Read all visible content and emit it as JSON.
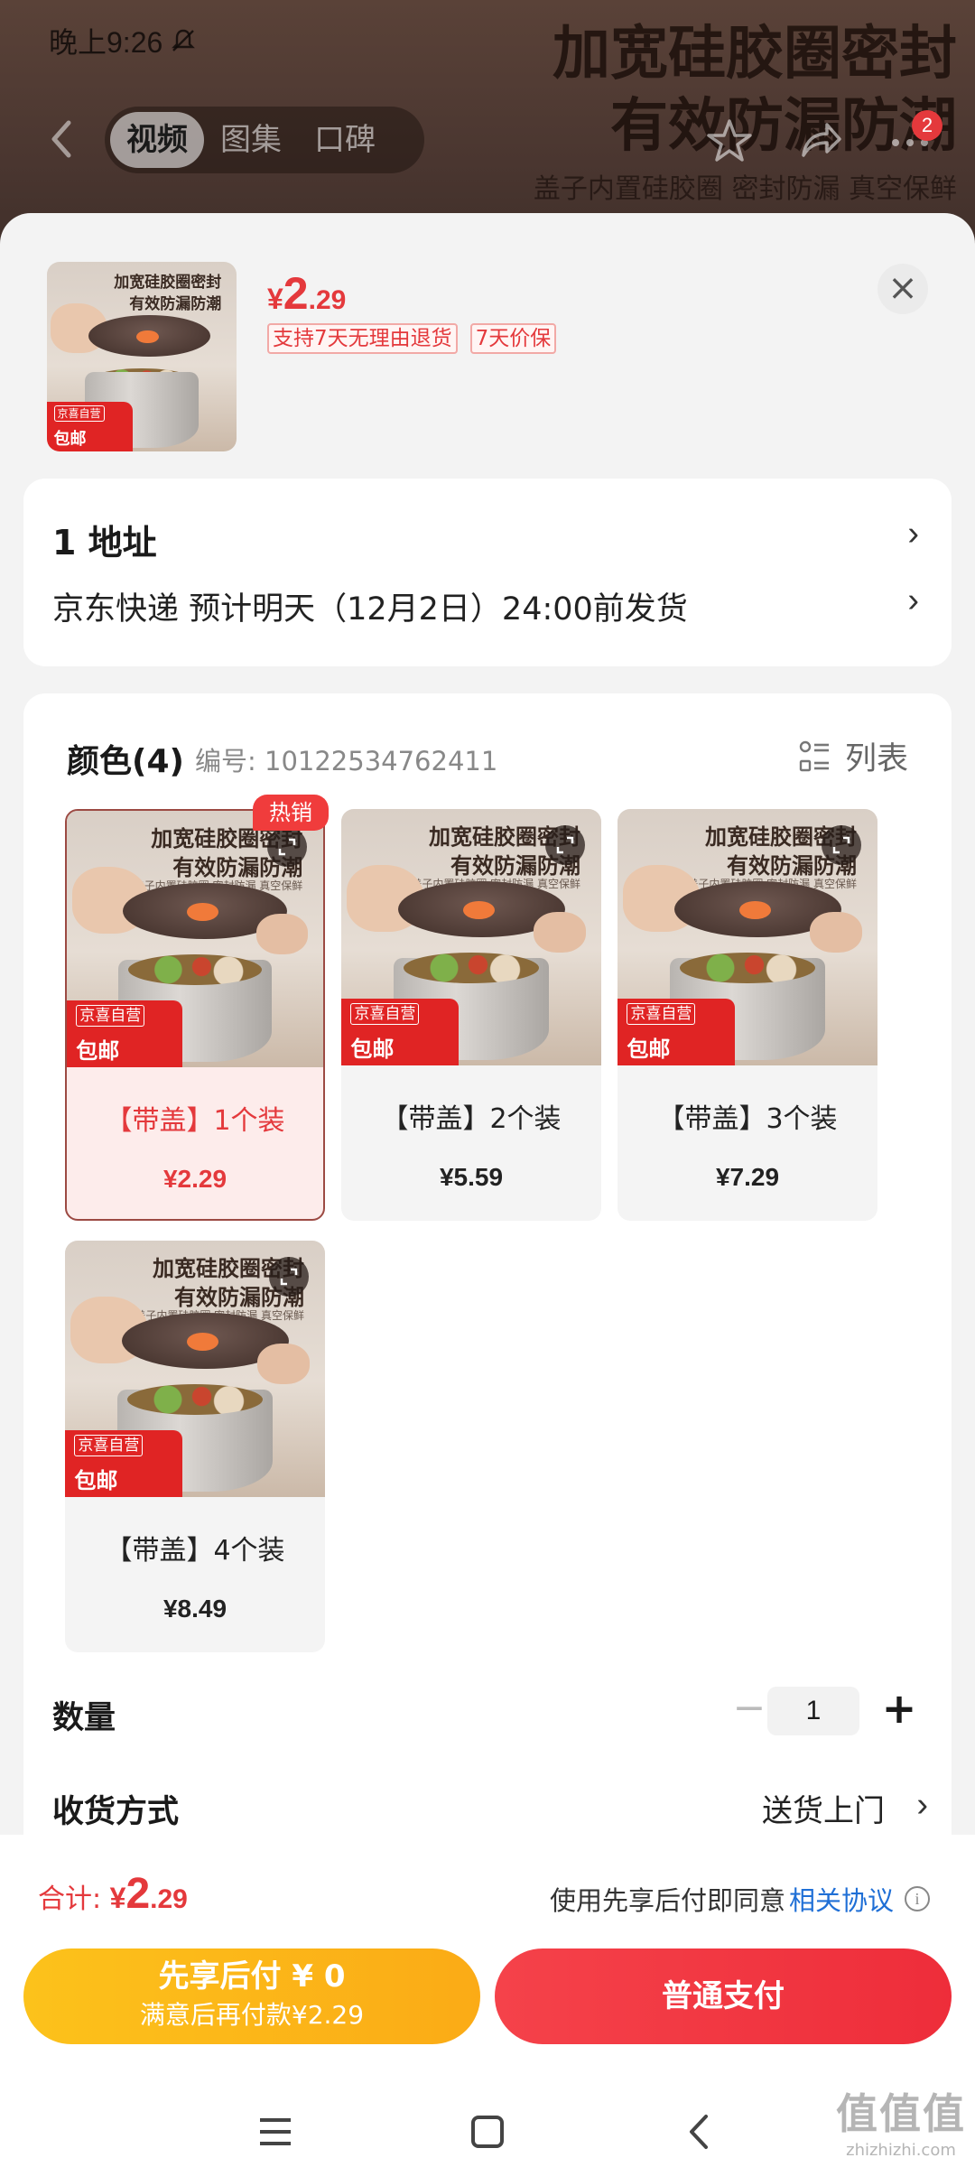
{
  "status_bar": {
    "time": "晚上9:26"
  },
  "background": {
    "hero_line1": "加宽硅胶圈密封",
    "hero_line2": "有效防漏防潮",
    "hero_sub": "盖子内置硅胶圈 密封防漏 真空保鲜"
  },
  "top_nav": {
    "tabs": [
      {
        "label": "视频",
        "active": true
      },
      {
        "label": "图集",
        "active": false
      },
      {
        "label": "口碑",
        "active": false
      }
    ],
    "cart_badge": "2"
  },
  "product_header": {
    "currency": "¥",
    "price_int": "2",
    "price_dec": ".29",
    "tags": [
      "支持7天无理由退货",
      "7天价保"
    ],
    "close_icon": "close-icon"
  },
  "photo_text": {
    "line1": "加宽硅胶圈密封",
    "line2": "有效防漏防潮",
    "line3": "盖子内置硅胶圈 密封防漏 真空保鲜",
    "badge_top": "京喜自营",
    "badge_bottom": "包邮"
  },
  "address": {
    "title": "1  地址",
    "delivery": "京东快递 预计明天（12月2日）24:00前发货"
  },
  "spec": {
    "title": "颜色(4)",
    "sku_number": "编号: 10122534762411",
    "list_toggle": "列表",
    "hot_label": "热销",
    "options": [
      {
        "name": "【带盖】1个装",
        "price": "¥2.29",
        "selected": true
      },
      {
        "name": "【带盖】2个装",
        "price": "¥5.59",
        "selected": false
      },
      {
        "name": "【带盖】3个装",
        "price": "¥7.29",
        "selected": false
      },
      {
        "name": "【带盖】4个装",
        "price": "¥8.49",
        "selected": false
      }
    ]
  },
  "quantity": {
    "label": "数量",
    "value": "1",
    "minus": "−",
    "plus": "+"
  },
  "shipping": {
    "label": "收货方式",
    "value": "送货上门"
  },
  "footer": {
    "total_label": "合计: ",
    "currency": "¥",
    "total_int": "2",
    "total_dec": ".29",
    "agree_text": "使用先享后付即同意",
    "agree_link": "相关协议",
    "bnpl_line1": "先享后付 ¥ 0",
    "bnpl_line2": "满意后再付款¥2.29",
    "pay_label": "普通支付"
  },
  "watermark": {
    "line1": "值值值",
    "line2": "zhizhizhi.com"
  },
  "colors": {
    "accent": "#e4393c",
    "bnpl": "#fbb418",
    "link": "#1f6fd6"
  }
}
